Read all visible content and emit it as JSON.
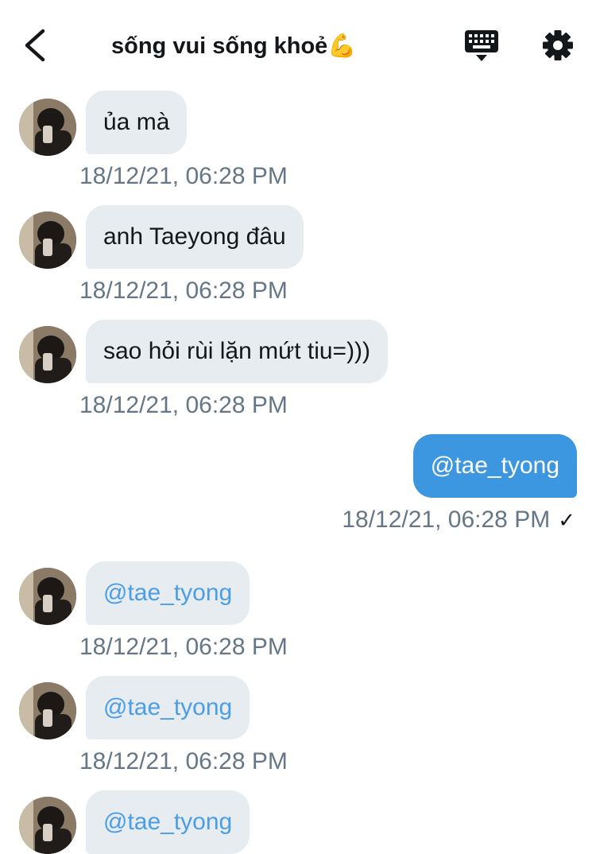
{
  "header": {
    "title": "sống vui sống khoẻ💪",
    "back_icon": "chevron-left-icon",
    "keyboard_icon": "keyboard-icon",
    "settings_icon": "gear-icon"
  },
  "messages": [
    {
      "direction": "in",
      "text": "ủa mà",
      "time": "18/12/21, 06:28 PM"
    },
    {
      "direction": "in",
      "text": "anh Taeyong đâu",
      "time": "18/12/21, 06:28 PM"
    },
    {
      "direction": "in",
      "text": "sao hỏi rùi lặn mứt tiu=)))",
      "time": "18/12/21, 06:28 PM"
    },
    {
      "direction": "out",
      "text": "@tae_tyong",
      "time": "18/12/21, 06:28 PM",
      "status": "✓"
    },
    {
      "direction": "in",
      "text": "@tae_tyong",
      "time": "18/12/21, 06:28 PM"
    },
    {
      "direction": "in",
      "text": "@tae_tyong",
      "time": "18/12/21, 06:28 PM"
    },
    {
      "direction": "in",
      "text": "@tae_tyong"
    }
  ],
  "colors": {
    "incoming_bubble": "#e6ecf0",
    "outgoing_bubble": "#3d96e0",
    "mention_link": "#4a9ee6",
    "timestamp": "#657786"
  }
}
